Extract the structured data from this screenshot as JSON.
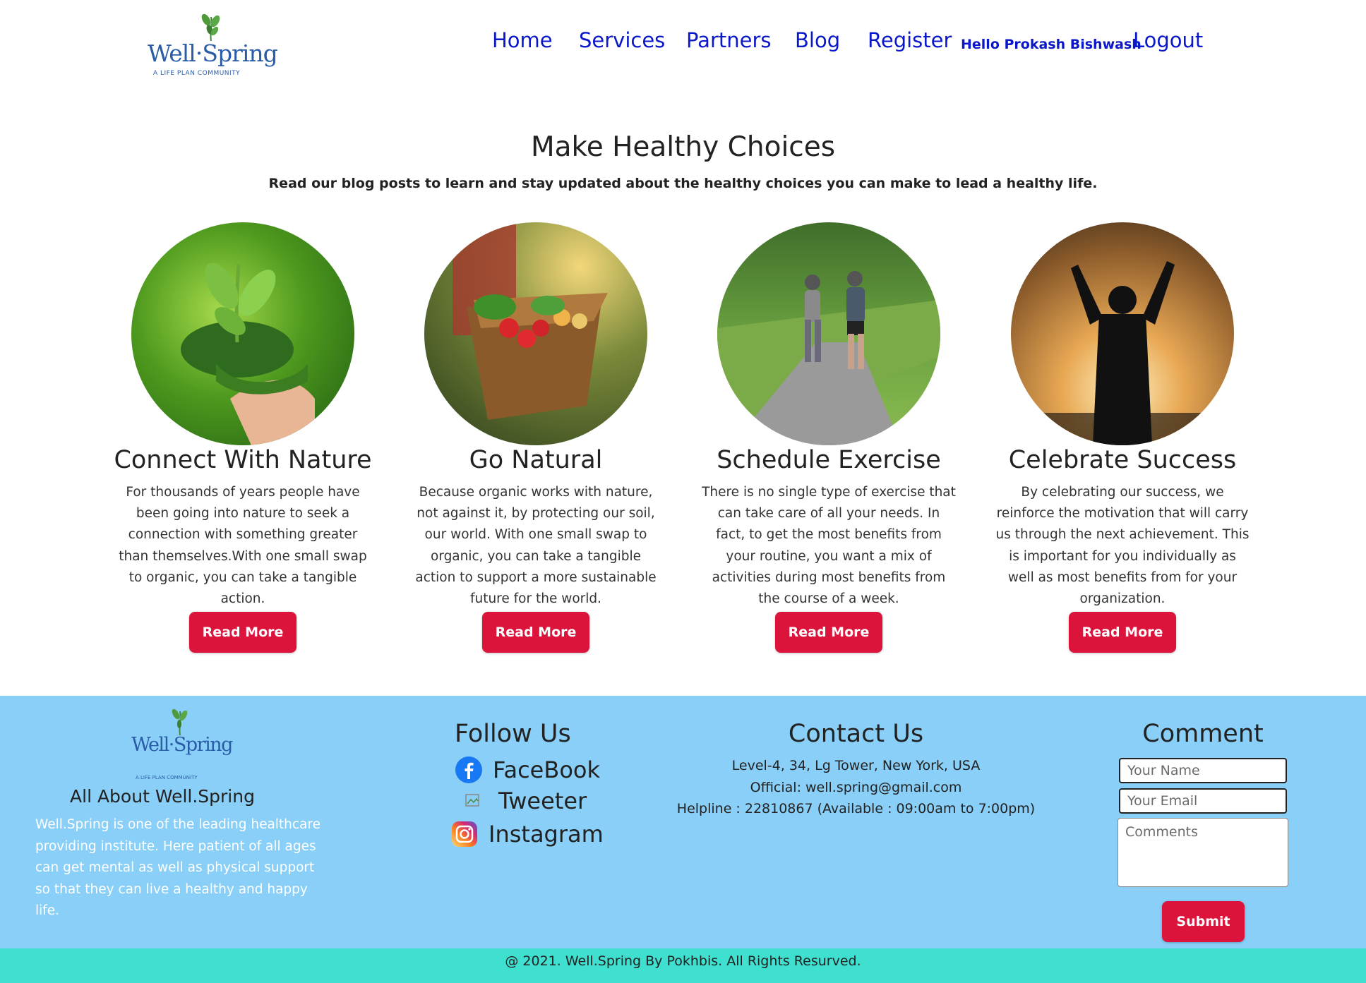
{
  "header": {
    "logo": {
      "brand": "Well·Spring",
      "tagline": "A LIFE PLAN COMMUNITY"
    },
    "nav": [
      {
        "label": "Home"
      },
      {
        "label": "Services"
      },
      {
        "label": "Partners"
      },
      {
        "label": "Blog"
      },
      {
        "label": "Register"
      }
    ],
    "greeting": "Hello Prokash Bishwash",
    "logout": "Logout"
  },
  "main": {
    "title": "Make Healthy Choices",
    "subtitle": "Read our blog posts to learn and stay updated about the healthy choices you can make to lead a healthy life.",
    "cards": [
      {
        "title": "Connect With Nature",
        "text": "For thousands of years people have been going into nature to seek a connection with something greater than themselves.With one small swap to organic, you can take a tangible action.",
        "button": "Read More"
      },
      {
        "title": "Go Natural",
        "text": "Because organic works with nature, not against it, by protecting our soil, our world. With one small swap to organic, you can take a tangible action to support a more sustainable future for the world.",
        "button": "Read More"
      },
      {
        "title": "Schedule Exercise",
        "text": "There is no single type of exercise that can take care of all your needs. In fact, to get the most benefits from your routine, you want a mix of activities during most benefits from the course of a week.",
        "button": "Read More"
      },
      {
        "title": "Celebrate Success",
        "text": "By celebrating our success, we reinforce the motivation that will carry us through the next achievement. This is important for you individually as well as most benefits from for your organization.",
        "button": "Read More"
      }
    ]
  },
  "footer": {
    "about": {
      "title": "All About Well.Spring",
      "text": "Well.Spring is one of the leading healthcare providing institute. Here patient of all ages can get mental as well as physical support so that they can live a healthy and happy life."
    },
    "follow": {
      "title": "Follow Us",
      "links": [
        {
          "label": "FaceBook",
          "icon": "facebook-icon"
        },
        {
          "label": "Tweeter",
          "icon": "broken-image-icon"
        },
        {
          "label": "Instagram",
          "icon": "instagram-icon"
        }
      ]
    },
    "contact": {
      "title": "Contact Us",
      "address": "Level-4, 34, Lg Tower, New York, USA",
      "official": "Official: well.spring@gmail.com",
      "helpline": "Helpline : 22810867 (Available : 09:00am to 7:00pm)"
    },
    "comment": {
      "title": "Comment",
      "name_placeholder": "Your Name",
      "email_placeholder": "Your Email",
      "comments_placeholder": "Comments",
      "submit": "Submit"
    },
    "copyright": "@ 2021. Well.Spring By Pokhbis. All Rights Resurved."
  },
  "colors": {
    "nav_link": "#0b18c8",
    "button": "#dc143c",
    "footer_bg": "#89cff7",
    "copyright_bg": "#40e0d0"
  }
}
